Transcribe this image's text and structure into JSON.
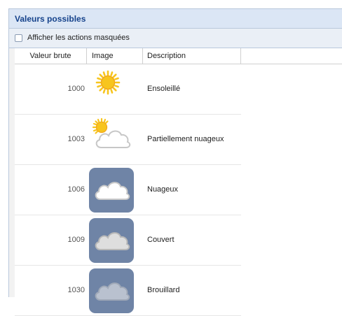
{
  "panel": {
    "title": "Valeurs possibles",
    "show_hidden_label": "Afficher les actions masquées"
  },
  "columns": {
    "raw": "Valeur brute",
    "image": "Image",
    "description": "Description"
  },
  "rows": [
    {
      "raw": "1000",
      "description": "Ensoleillé",
      "icon": "sun-icon"
    },
    {
      "raw": "1003",
      "description": "Partiellement nuageux",
      "icon": "partly-cloudy-icon"
    },
    {
      "raw": "1006",
      "description": "Nuageux",
      "icon": "cloudy-icon"
    },
    {
      "raw": "1009",
      "description": "Couvert",
      "icon": "overcast-icon"
    },
    {
      "raw": "1030",
      "description": "Brouillard",
      "icon": "fog-icon"
    }
  ],
  "colors": {
    "header_bg": "#dbe6f5",
    "title_text": "#15428b",
    "tile_bg": "#6f84a6",
    "sun": "#f7c51e"
  }
}
